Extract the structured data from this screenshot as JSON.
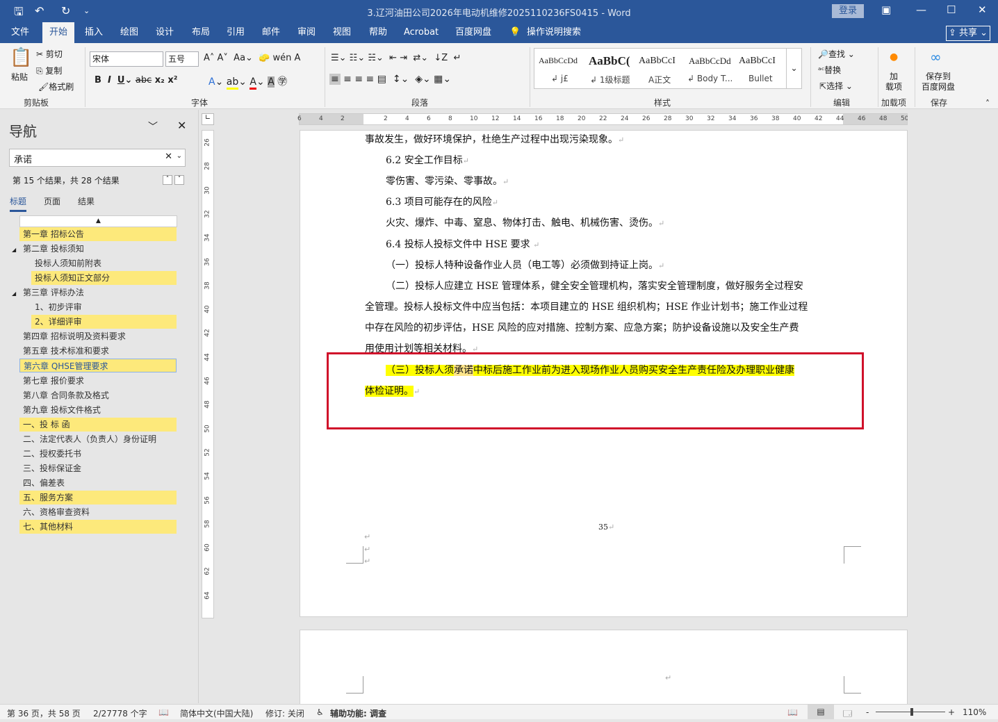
{
  "titlebar": {
    "title": "3.辽河油田公司2026年电动机维修2025110236FS0415  -  Word",
    "login": "登录",
    "qat_more": "⌄"
  },
  "tabs": [
    "文件",
    "开始",
    "插入",
    "绘图",
    "设计",
    "布局",
    "引用",
    "邮件",
    "审阅",
    "视图",
    "帮助",
    "Acrobat",
    "百度网盘"
  ],
  "tell_me": "操作说明搜索",
  "share": "共享",
  "ribbon": {
    "clipboard": {
      "paste": "粘贴",
      "cut": "剪切",
      "copy": "复制",
      "format_painter": "格式刷",
      "label": "剪贴板"
    },
    "font": {
      "name": "宋体",
      "size": "五号",
      "label": "字体"
    },
    "paragraph": {
      "label": "段落"
    },
    "styles": {
      "label": "样式",
      "items": [
        {
          "preview": "AaBbCcDd",
          "name": "↲ j£"
        },
        {
          "preview": "AaBbC(",
          "name": "↲ 1级标题"
        },
        {
          "preview": "AaBbCcI",
          "name": "A正文"
        },
        {
          "preview": "AaBbCcDd",
          "name": "↲ Body T..."
        },
        {
          "preview": "AaBbCcI",
          "name": "Bullet"
        }
      ]
    },
    "editing": {
      "find": "查找",
      "replace": "替换",
      "select": "选择",
      "label": "编辑"
    },
    "addins": {
      "button": "加\n载项",
      "label": "加载项"
    },
    "save": {
      "button": "保存到\n百度网盘",
      "label": "保存"
    }
  },
  "nav": {
    "title": "导航",
    "search_value": "承诺",
    "result_text": "第 15 个结果，共 28 个结果",
    "tabs": [
      "标题",
      "页面",
      "结果"
    ],
    "headings": [
      {
        "text": "第一章  招标公告",
        "level": 1,
        "highlight": true
      },
      {
        "text": "第二章  投标须知",
        "level": 1,
        "expanded": true
      },
      {
        "text": "投标人须知前附表",
        "level": 2
      },
      {
        "text": "投标人须知正文部分",
        "level": 2,
        "highlight": true
      },
      {
        "text": "第三章  评标办法",
        "level": 1,
        "expanded": true
      },
      {
        "text": "1、初步评审",
        "level": 2
      },
      {
        "text": "2、详细评审",
        "level": 2,
        "highlight": true
      },
      {
        "text": "第四章  招标说明及资料要求",
        "level": 1
      },
      {
        "text": "第五章 技术标准和要求",
        "level": 1
      },
      {
        "text": "第六章  QHSE管理要求",
        "level": 1,
        "highlight": true,
        "selected": true
      },
      {
        "text": "第七章  报价要求",
        "level": 1
      },
      {
        "text": "第八章  合同条款及格式",
        "level": 1
      },
      {
        "text": "第九章  投标文件格式",
        "level": 1
      },
      {
        "text": "一、投 标 函",
        "level": 1,
        "highlight": true
      },
      {
        "text": "二、法定代表人（负责人）身份证明",
        "level": 1
      },
      {
        "text": "二、授权委托书",
        "level": 1
      },
      {
        "text": "三、投标保证金",
        "level": 1
      },
      {
        "text": "四、偏差表",
        "level": 1
      },
      {
        "text": "五、服务方案",
        "level": 1,
        "highlight": true
      },
      {
        "text": "六、资格审查资料",
        "level": 1
      },
      {
        "text": "七、其他材料",
        "level": 1,
        "highlight": true
      }
    ]
  },
  "rulers": {
    "h": [
      "6",
      "4",
      "2",
      "",
      "2",
      "4",
      "6",
      "8",
      "10",
      "12",
      "14",
      "16",
      "18",
      "20",
      "22",
      "24",
      "26",
      "28",
      "30",
      "32",
      "34",
      "36",
      "38",
      "40",
      "42",
      "44",
      "46",
      "48",
      "50"
    ],
    "v": [
      "26",
      "28",
      "30",
      "32",
      "34",
      "36",
      "38",
      "40",
      "42",
      "44",
      "46",
      "48",
      "50",
      "52",
      "54",
      "56",
      "58",
      "60",
      "62",
      "64"
    ]
  },
  "document": {
    "lines": [
      {
        "text": "事故发生，做好环境保护，杜绝生产过程中出现污染现象。",
        "indent": false
      },
      {
        "text": "6.2 安全工作目标",
        "indent": true
      },
      {
        "text": "零伤害、零污染、零事故。",
        "indent": true
      },
      {
        "text": "6.3 项目可能存在的风险",
        "indent": true
      },
      {
        "text": "火灾、爆炸、中毒、窒息、物体打击、触电、机械伤害、烫伤。",
        "indent": true
      },
      {
        "text": "6.4 投标人投标文件中 HSE 要求 ",
        "indent": true
      },
      {
        "text": "（一）投标人特种设备作业人员（电工等）必须做到持证上岗。",
        "indent": true
      },
      {
        "text": "（二）投标人应建立 HSE 管理体系，健全安全管理机构，落实安全管理制度，做好服务全过程安",
        "indent": true
      },
      {
        "text": "全管理。投标人投标文件中应当包括：本项目建立的 HSE 组织机构；HSE 作业计划书；施工作业过程",
        "indent": false
      },
      {
        "text": "中存在风险的初步评估，HSE 风险的应对措施、控制方案、应急方案；防护设备设施以及安全生产费",
        "indent": false
      },
      {
        "text": "用使用计划等相关材料。",
        "indent": false
      }
    ],
    "highlight_para": {
      "before": "（三）投标人须",
      "match": "承诺",
      "after": "中标后施工作业前为进入现场作业人员购买安全生产责任险及办理职业健康",
      "line2": "体检证明。"
    },
    "page_number": "35",
    "para_mark": "↵"
  },
  "status": {
    "page": "第 36 页，共 58 页",
    "words": "2/27778 个字",
    "language": "简体中文(中国大陆)",
    "track": "修订: 关闭",
    "accessibility": "辅助功能: 调查",
    "zoom": "110%",
    "zoom_level": 110
  },
  "colors": {
    "brand": "#2b579a",
    "highlight": "#ffff00",
    "nav_highlight": "#fde97b",
    "annotation": "#d0102a"
  }
}
